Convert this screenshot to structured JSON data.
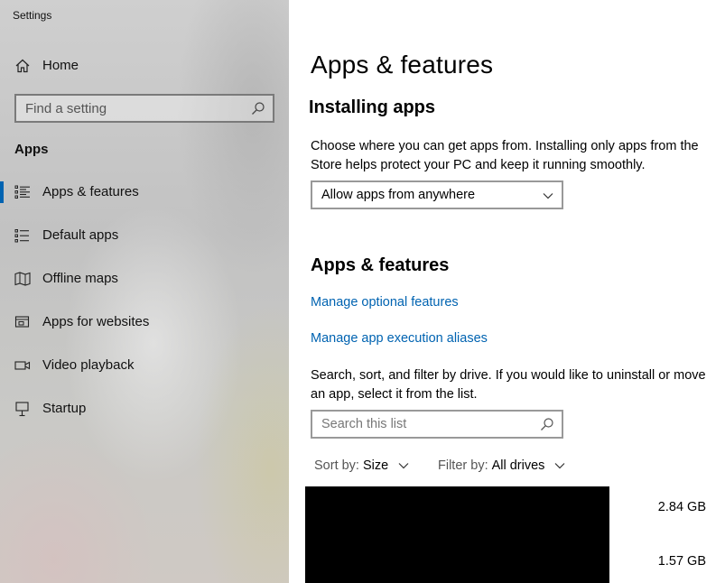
{
  "window": {
    "title": "Settings"
  },
  "sidebar": {
    "home_label": "Home",
    "search_placeholder": "Find a setting",
    "section_heading": "Apps",
    "items": [
      {
        "label": "Apps & features",
        "icon": "apps-features-icon",
        "active": true
      },
      {
        "label": "Default apps",
        "icon": "default-apps-icon",
        "active": false
      },
      {
        "label": "Offline maps",
        "icon": "map-icon",
        "active": false
      },
      {
        "label": "Apps for websites",
        "icon": "apps-websites-icon",
        "active": false
      },
      {
        "label": "Video playback",
        "icon": "video-icon",
        "active": false
      },
      {
        "label": "Startup",
        "icon": "startup-icon",
        "active": false
      }
    ]
  },
  "main": {
    "title": "Apps & features",
    "installing": {
      "heading": "Installing apps",
      "description": "Choose where you can get apps from. Installing only apps from the Store helps protect your PC and keep it running smoothly.",
      "dropdown_value": "Allow apps from anywhere"
    },
    "features": {
      "heading": "Apps & features",
      "link_optional": "Manage optional features",
      "link_aliases": "Manage app execution aliases",
      "description": "Search, sort, and filter by drive. If you would like to uninstall or move an app, select it from the list.",
      "search_placeholder": "Search this list",
      "sort_label": "Sort by:",
      "sort_value": "Size",
      "filter_label": "Filter by:",
      "filter_value": "All drives"
    },
    "apps": [
      {
        "size": "2.84 GB"
      },
      {
        "size": "1.57 GB"
      }
    ]
  },
  "colors": {
    "accent": "#0063b1",
    "link": "#0063b1",
    "redacted_block": "#000000"
  }
}
